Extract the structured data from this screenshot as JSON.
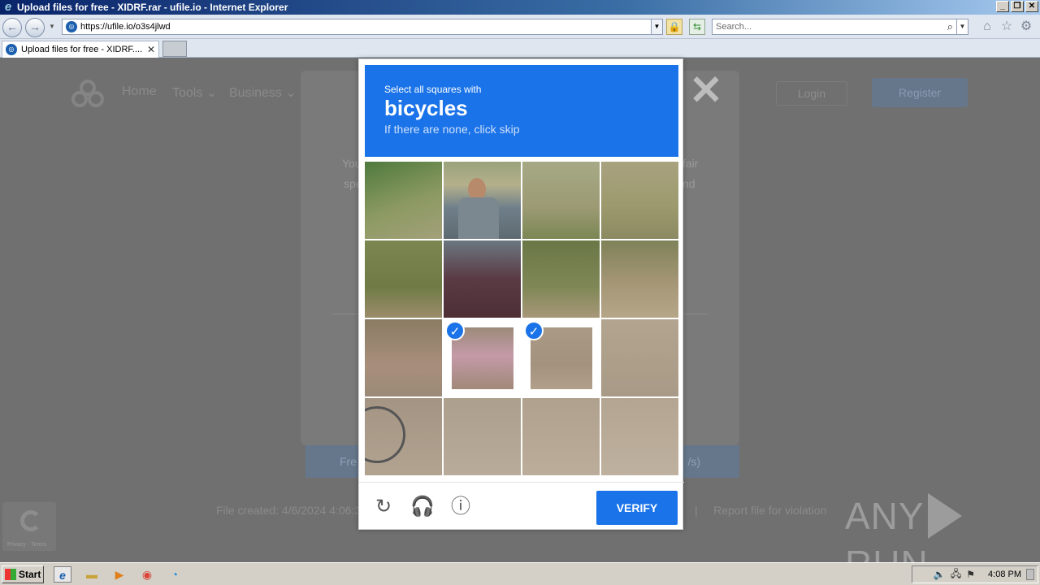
{
  "window": {
    "title": "Upload files for free - XIDRF.rar - ufile.io - Internet Explorer",
    "controls": [
      "_",
      "❐",
      "✕"
    ]
  },
  "navbar": {
    "url": "https://ufile.io/o3s4jlwd",
    "search_placeholder": "Search..."
  },
  "tabs": [
    {
      "label": "Upload files for free - XIDRF....",
      "active": true
    }
  ],
  "site": {
    "nav": [
      "Home",
      "Tools ⌄",
      "Business ⌄"
    ],
    "login": "Login",
    "register": "Register",
    "bg_text": [
      "You",
      "fair",
      "spe",
      "nd"
    ],
    "free_left": "Fre",
    "free_right": "/s)",
    "file_created": "File created: 4/6/2024 4:06:3",
    "report": "Report file for violation",
    "report_sep": "|",
    "recaptcha_text": "Privacy - Terms"
  },
  "captcha": {
    "instruction": "Select all squares with",
    "target": "bicycles",
    "hint": "If there are none, click skip",
    "selected_tiles": [
      9,
      10
    ],
    "verify_label": "VERIFY",
    "icons": [
      "reload-icon",
      "headphones-icon",
      "info-icon"
    ]
  },
  "watermark": {
    "left": "ANY",
    "right": "RUN"
  },
  "taskbar": {
    "start_label": "Start",
    "clock": "4:08 PM"
  }
}
